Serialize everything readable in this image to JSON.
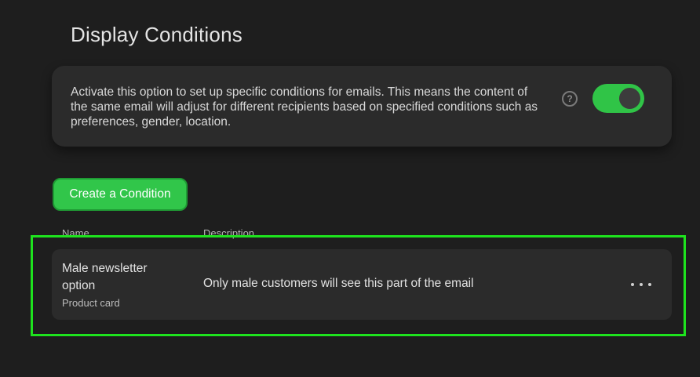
{
  "page": {
    "title": "Display Conditions"
  },
  "info_card": {
    "text": "Activate this option to set up specific conditions for emails. This means the content of the same email will adjust for different recipients based on specified conditions such as preferences, gender, location.",
    "help_icon": "?",
    "toggle_on": true
  },
  "actions": {
    "create_label": "Create a Condition"
  },
  "table": {
    "columns": [
      "Name",
      "Description"
    ],
    "rows": [
      {
        "name": "Male newsletter option",
        "type": "Product card",
        "description": "Only male customers will see this part of the email"
      }
    ]
  },
  "colors": {
    "accent": "#31c64a",
    "highlight": "#1ee31e",
    "background": "#1e1e1e",
    "card": "#2b2b2b"
  }
}
